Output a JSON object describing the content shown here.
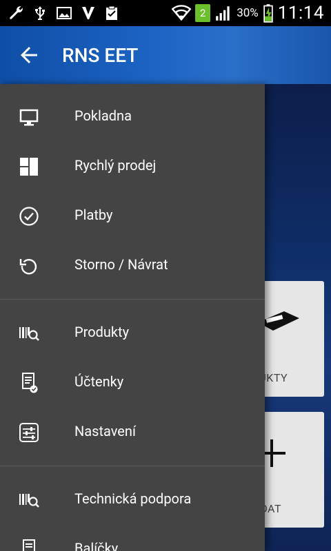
{
  "status_bar": {
    "sim_badge": "2",
    "battery_percent": "30%",
    "time": "11:14"
  },
  "app_bar": {
    "title": "RNS EET"
  },
  "background_cards": {
    "card1_label": "ODUKTY",
    "card2_label": "ŘIDAT"
  },
  "drawer": {
    "items": [
      {
        "label": "Pokladna",
        "icon": "monitor-icon"
      },
      {
        "label": "Rychlý prodej",
        "icon": "tiles-icon"
      },
      {
        "label": "Platby",
        "icon": "check-circle-icon"
      },
      {
        "label": "Storno / Návrat",
        "icon": "undo-icon"
      },
      {
        "label": "Produkty",
        "icon": "barcode-search-icon"
      },
      {
        "label": "Účtenky",
        "icon": "receipt-check-icon"
      },
      {
        "label": "Nastavení",
        "icon": "sliders-icon"
      },
      {
        "label": "Technická podpora",
        "icon": "barcode-search-icon"
      },
      {
        "label": "Balíčky",
        "icon": "document-icon"
      }
    ]
  },
  "colors": {
    "app_bar": "#1c63c3",
    "drawer_bg": "#444444",
    "status_badge": "#6bbf2a"
  }
}
